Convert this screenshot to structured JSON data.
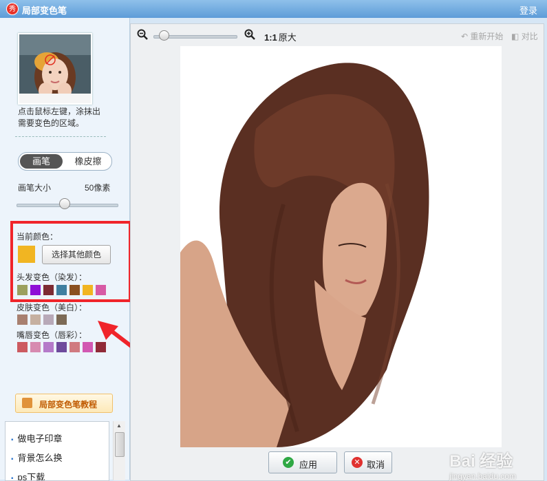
{
  "title_bar": {
    "app_title": "局部变色笔",
    "login": "登录",
    "logo_glyph": "秀"
  },
  "left_panel": {
    "hint_line1": "点击鼠标左键，涂抹出",
    "hint_line2": "需要变色的区域。",
    "tool_toggle": {
      "active": "画笔",
      "inactive": "橡皮擦"
    },
    "brush_size": {
      "label": "画笔大小",
      "value": "50像素",
      "slider_fraction": 0.47
    },
    "current_color": {
      "label": "当前颜色：",
      "color": "#f1b522",
      "choose_button": "选择其他颜色"
    },
    "hair": {
      "label": "头发变色（染发）：",
      "colors": [
        "#9ba05e",
        "#8e0fd6",
        "#7d2b33",
        "#3f7fa0",
        "#8a5020",
        "#f1b522",
        "#d75aa5"
      ]
    },
    "skin": {
      "label": "皮肤变色（美白）：",
      "colors": [
        "#a88070",
        "#c6b0a0",
        "#b8a9b8",
        "#7c6a56"
      ]
    },
    "lips": {
      "label": "嘴唇变色（唇彩）：",
      "colors": [
        "#cc5a60",
        "#d78ab0",
        "#b57ac9",
        "#6e4a9c",
        "#d07a80",
        "#d258b2",
        "#902a38"
      ]
    },
    "tutorial_button": "局部变色笔教程",
    "related_list": [
      "做电子印章",
      "背景怎么换",
      "ps下载"
    ],
    "highlight_color": "#f0242a"
  },
  "main_panel": {
    "toolbar": {
      "ratio_bold": "1:1",
      "ratio_label": "原大",
      "restart": "重新开始",
      "compare": "对比",
      "zoom_fraction": 0.12
    },
    "apply_button": "应用",
    "cancel_button": "取消",
    "watermark": {
      "logo": "Bai 经验",
      "url": "jingyan.baidu.com"
    }
  }
}
